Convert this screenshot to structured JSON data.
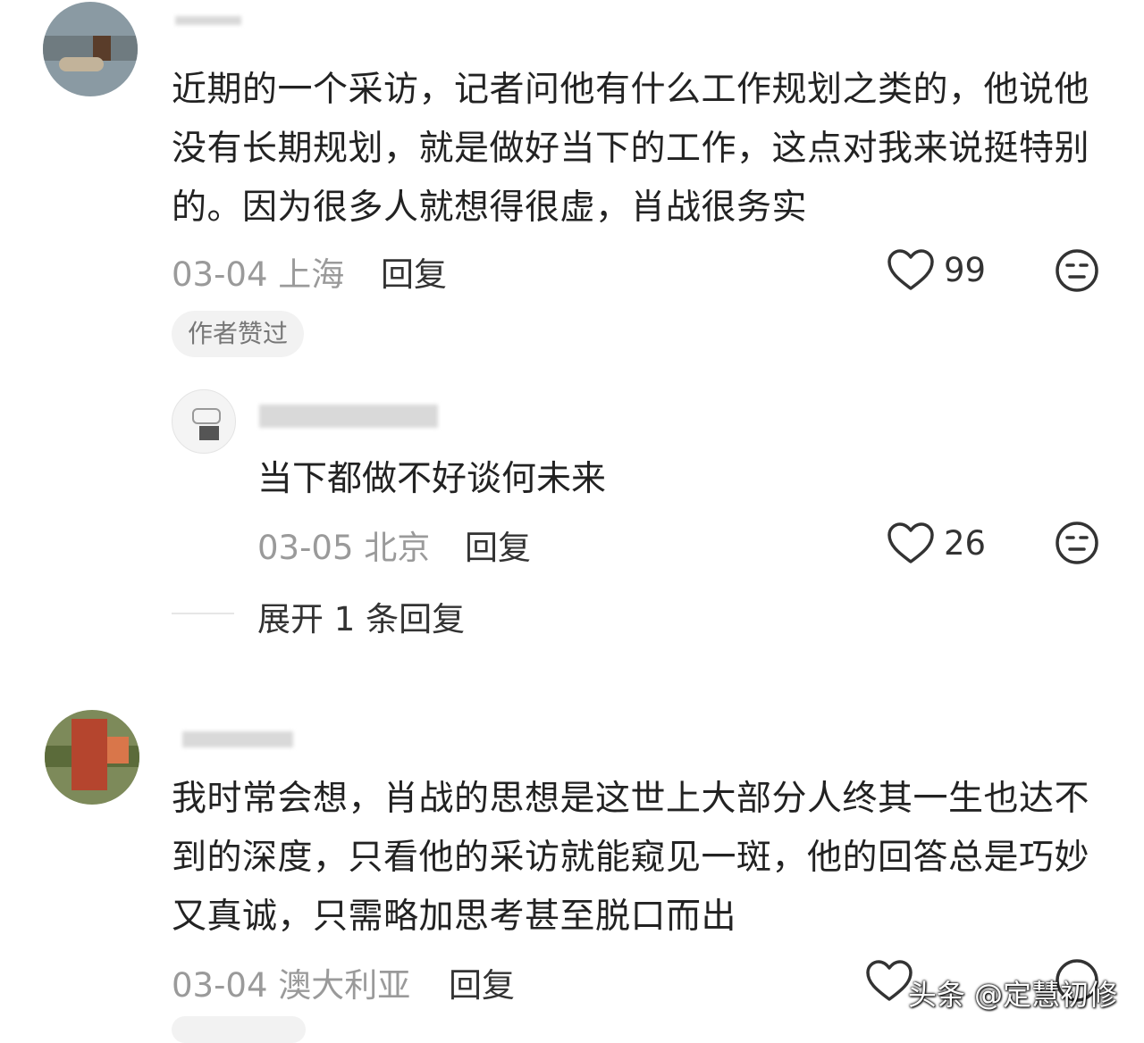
{
  "comments": [
    {
      "text": "近期的一个采访，记者问他有什么工作规划之类的，他说他没有长期规划，就是做好当下的工作，这点对我来说挺特别的。因为很多人就想得很虚，肖战很务实",
      "date": "03-04",
      "location": "上海",
      "reply_label": "回复",
      "likes": "99",
      "badge": "作者赞过",
      "replies": [
        {
          "text": "当下都做不好谈何未来",
          "date": "03-05",
          "location": "北京",
          "reply_label": "回复",
          "likes": "26"
        }
      ],
      "expand_label": "展开 1 条回复"
    },
    {
      "text": "我时常会想，肖战的思想是这世上大部分人终其一生也达不到的深度，只看他的采访就能窥见一斑，他的回答总是巧妙又真诚，只需略加思考甚至脱口而出",
      "date": "03-04",
      "location": "澳大利亚",
      "reply_label": "回复"
    }
  ],
  "watermark": "头条 @定慧初修",
  "icons": {
    "like": "heart-outline-icon",
    "emoji": "neutral-face-icon"
  }
}
